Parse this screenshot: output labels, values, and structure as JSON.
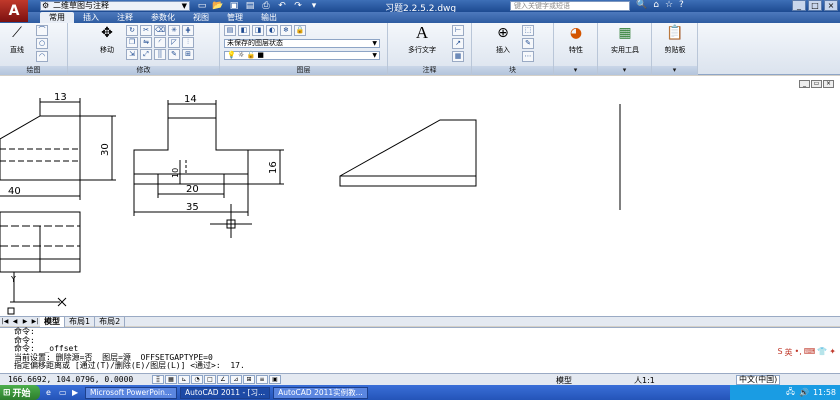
{
  "title": {
    "workspace": "二维草图与注释",
    "doc_title": "习题2.2.5.2.dwg",
    "help_placeholder": "键入关键字或短语"
  },
  "ribbon": {
    "tabs": [
      "常用",
      "插入",
      "注释",
      "参数化",
      "视图",
      "管理",
      "输出"
    ],
    "active_tab": "常用",
    "panels": {
      "draw": "绘图",
      "modify": "修改",
      "layer": "图层",
      "annotation": "注释",
      "block": "块"
    },
    "buttons": {
      "line": "直线",
      "move": "移动",
      "multiline_text": "多行文字",
      "insert": "插入",
      "properties": "特性",
      "utilities": "实用工具",
      "clipboard": "剪贴板"
    },
    "layer_state": "未保存的图层状态"
  },
  "drawing": {
    "dims": {
      "d13": "13",
      "d30": "30",
      "d40": "40",
      "d14": "14",
      "d10": "10",
      "d20": "20",
      "d35": "35",
      "d16": "16"
    }
  },
  "layout_tabs": [
    "模型",
    "布局1",
    "布局2"
  ],
  "cmdline": [
    "命令:",
    "命令:",
    "命令:  _offset",
    "当前设置: 删除源=否  图层=源  OFFSETGAPTYPE=0",
    "指定偏移距离或 [通过(T)/删除(E)/图层(L)] <通过>:  17."
  ],
  "ime": "英",
  "status": {
    "coords": "166.6692, 104.0796, 0.0000",
    "model": "模型",
    "anno_scale": "人1:1",
    "ime_lang": "中文(中国)"
  },
  "taskbar": {
    "start": "开始",
    "tasks": [
      "Microsoft PowerPoin...",
      "AutoCAD 2011 - [习...",
      "AutoCAD 2011实例教..."
    ],
    "time": "11:58"
  }
}
